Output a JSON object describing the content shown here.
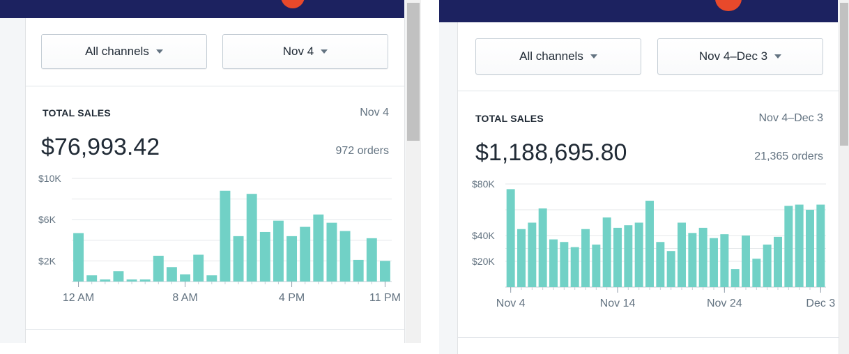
{
  "colors": {
    "topbar": "#1c2260",
    "bar": "#71d1c6",
    "grid": "#e4e7ea",
    "avatar": "#e8492b"
  },
  "panels": [
    {
      "channel_label": "All channels",
      "date_label": "Nov 4",
      "section_title": "TOTAL SALES",
      "section_date": "Nov 4",
      "total_value": "$76,993.42",
      "orders": "972 orders",
      "chart_data": {
        "type": "bar",
        "title": "",
        "xlabel": "",
        "ylabel": "",
        "y_tick_labels": [
          "$10K",
          "$6K",
          "$2K"
        ],
        "y_tick_values": [
          10000,
          6000,
          2000
        ],
        "ylim": [
          0,
          10000
        ],
        "x_tick_labels": [
          "12 AM",
          "8 AM",
          "4 PM",
          "11 PM"
        ],
        "x_tick_indices": [
          0,
          8,
          16,
          23
        ],
        "grid": true,
        "values": [
          4700,
          600,
          200,
          1000,
          200,
          200,
          2500,
          1400,
          700,
          2600,
          600,
          8800,
          4400,
          8500,
          4800,
          5900,
          4400,
          5300,
          6500,
          5700,
          4900,
          2100,
          4200,
          2000
        ]
      }
    },
    {
      "channel_label": "All channels",
      "date_label": "Nov 4–Dec 3",
      "section_title": "TOTAL SALES",
      "section_date": "Nov 4–Dec 3",
      "total_value": "$1,188,695.80",
      "orders": "21,365 orders",
      "chart_data": {
        "type": "bar",
        "title": "",
        "xlabel": "",
        "ylabel": "",
        "y_tick_labels": [
          "$80K",
          "$40K",
          "$20K"
        ],
        "y_tick_values": [
          80000,
          40000,
          20000
        ],
        "ylim": [
          0,
          80000
        ],
        "x_tick_labels": [
          "Nov 4",
          "Nov 14",
          "Nov 24",
          "Dec 3"
        ],
        "x_tick_indices": [
          0,
          10,
          20,
          29
        ],
        "grid": true,
        "values": [
          76000,
          45000,
          50000,
          61000,
          37000,
          35000,
          31000,
          45000,
          33000,
          54000,
          46000,
          48000,
          50000,
          67000,
          35000,
          28000,
          50000,
          42000,
          46000,
          38000,
          41000,
          14000,
          40000,
          22000,
          33000,
          39000,
          63000,
          64000,
          60000,
          64000
        ]
      }
    }
  ]
}
